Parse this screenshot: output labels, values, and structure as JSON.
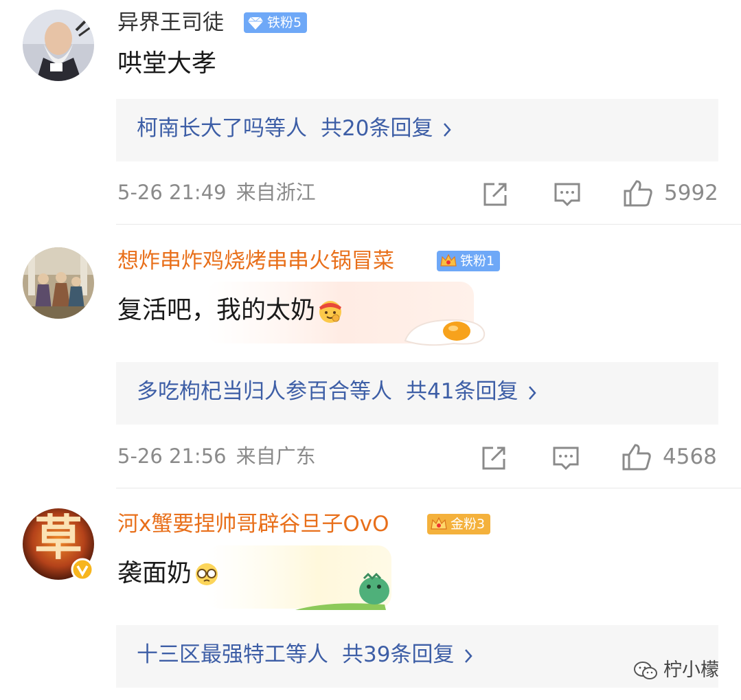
{
  "colors": {
    "link": "#3d5ea6",
    "meta": "#8a8a8a",
    "vip_name": "#e86f1a",
    "badge_iron": "#6ea8f7",
    "badge_gold": "#f4b13c",
    "reply_bg": "#f6f6f6"
  },
  "comments": [
    {
      "username": "异界王司徒",
      "badge": "铁粉5",
      "text": "哄堂大孝",
      "replies_people": "柯南长大了吗等人",
      "replies_count": "共20条回复",
      "time": "5-26 21:49",
      "location": "来自浙江",
      "likes": "5992"
    },
    {
      "username": "想炸串炸鸡烧烤串串火锅冒菜",
      "badge": "铁粉1",
      "text": "复活吧，我的太奶",
      "replies_people": "多吃枸杞当归人参百合等人",
      "replies_count": "共41条回复",
      "time": "5-26 21:56",
      "location": "来自广东",
      "likes": "4568"
    },
    {
      "username": "河x蟹要捏帅哥辟谷旦子OvO",
      "badge": "金粉3",
      "avatar_char": "草",
      "text": "袭面奶",
      "replies_people": "十三区最强特工等人",
      "replies_count": "共39条回复"
    }
  ],
  "watermark": "柠小檬",
  "icons": [
    "share-icon",
    "comment-icon",
    "like-icon",
    "chevron-right-icon",
    "wechat-icon",
    "diamond-icon",
    "crown-icon",
    "verified-icon"
  ]
}
